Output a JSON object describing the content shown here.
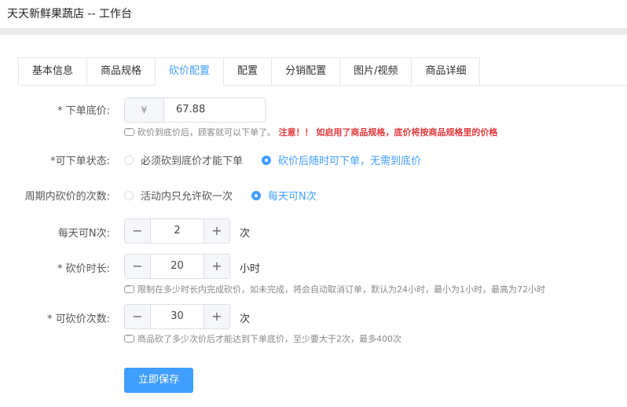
{
  "header": {
    "title": "天天新鲜果蔬店 -- 工作台"
  },
  "tabs": [
    {
      "label": "基本信息",
      "active": false
    },
    {
      "label": "商品规格",
      "active": false
    },
    {
      "label": "砍价配置",
      "active": true
    },
    {
      "label": "配置",
      "active": false
    },
    {
      "label": "分销配置",
      "active": false
    },
    {
      "label": "图片/视频",
      "active": false
    },
    {
      "label": "商品详细",
      "active": false
    }
  ],
  "form": {
    "min_price": {
      "label": "* 下单底价:",
      "prefix": "¥",
      "value": "67.88",
      "hint": "砍价到底价后，顾客就可以下单了。",
      "warning": "注意！！ 如启用了商品规格，底价将按商品规格里的价格"
    },
    "order_status": {
      "label": "*可下单状态:",
      "options": [
        "必须砍到底价才能下单",
        "砍价后随时可下单，无需到底价"
      ],
      "selected_index": 1
    },
    "cycle_count": {
      "label": "周期内砍价的次数:",
      "options": [
        "活动内只允许砍一次",
        "每天可N次"
      ],
      "selected_index": 1
    },
    "daily_n": {
      "label": "每天可N次:",
      "value": "2",
      "unit": "次"
    },
    "duration": {
      "label": "* 砍价时长:",
      "value": "20",
      "unit": "小时",
      "hint": "限制在多少时长内完成砍价，如未完成，将会自动取消订单，默认为24小时，最小为1小时，最高为72小时"
    },
    "cut_times": {
      "label": "* 可砍价次数:",
      "value": "30",
      "unit": "次",
      "hint": "商品砍了多少次价后才能达到下单底价，至少要大于2次，最多400次"
    },
    "stepper_minus": "−",
    "stepper_plus": "+"
  },
  "save_button": {
    "label": "立即保存"
  },
  "colors": {
    "primary": "#409eff",
    "warning": "#e4393c"
  },
  "icons": {
    "hint": "info-bubble-icon",
    "minus": "minus-icon",
    "plus": "plus-icon"
  }
}
